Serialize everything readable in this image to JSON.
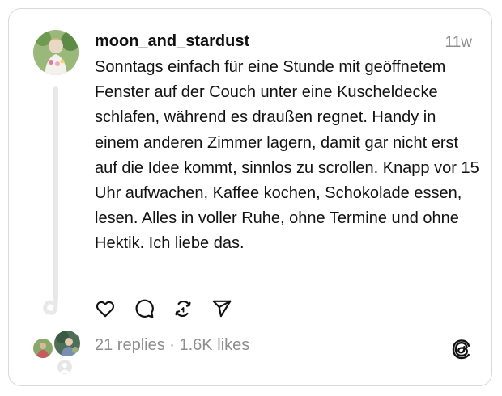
{
  "post": {
    "username": "moon_and_stardust",
    "time": "11w",
    "text": "Sonntags einfach für eine Stunde mit geöffnetem Fenster auf der Couch unter eine Kuscheldecke schlafen, während es draußen regnet. Handy in einem anderen Zimmer lagern, damit gar nicht erst auf die Idee kommt, sinnlos zu scrollen. Knapp vor 15 Uhr aufwachen, Kaffee kochen, Schokolade essen, lesen. Alles in voller Ruhe, ohne Termine und ohne Hektik. Ich liebe das.",
    "stats": "21 replies · 1.6K likes"
  },
  "actions": [
    {
      "icon": "heart-icon"
    },
    {
      "icon": "comment-icon"
    },
    {
      "icon": "repost-icon"
    },
    {
      "icon": "share-icon"
    }
  ],
  "colors": {
    "text": "#111111",
    "muted": "#8e8e8e",
    "border": "#d9d9d9",
    "thread_line": "#e8e8e8"
  }
}
